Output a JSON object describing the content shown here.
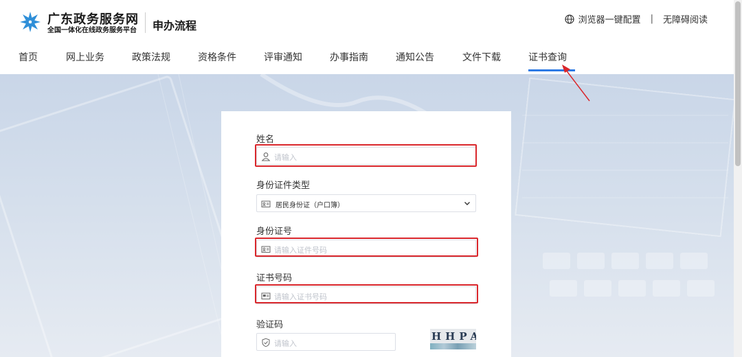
{
  "header": {
    "brand_title": "广东政务服务网",
    "brand_subtitle": "全国一体化在线政务服务平台",
    "section_title": "申办流程",
    "tools": {
      "browser_config": "浏览器一键配置",
      "separator": "|",
      "accessibility": "无障碍阅读"
    }
  },
  "nav": {
    "items": [
      {
        "label": "首页"
      },
      {
        "label": "网上业务"
      },
      {
        "label": "政策法规"
      },
      {
        "label": "资格条件"
      },
      {
        "label": "评审通知"
      },
      {
        "label": "办事指南"
      },
      {
        "label": "通知公告"
      },
      {
        "label": "文件下载"
      },
      {
        "label": "证书查询",
        "active": true
      }
    ]
  },
  "form": {
    "name": {
      "label": "姓名",
      "placeholder": "请输入"
    },
    "id_type": {
      "label": "身份证件类型",
      "value": "居民身份证（户口簿）"
    },
    "id_number": {
      "label": "身份证号",
      "placeholder": "请输入证件号码"
    },
    "cert_number": {
      "label": "证书号码",
      "placeholder": "请输入证书号码"
    },
    "captcha": {
      "label": "验证码",
      "placeholder": "请输入",
      "image_text": "HHPA"
    }
  },
  "colors": {
    "highlight": "#d9262b",
    "nav_active_underline": "#2d7be5",
    "logo": "#2f8fd8"
  },
  "icons": {
    "logo": "snowflake-logo-icon",
    "browser_config": "globe-icon",
    "name_field": "user-icon",
    "id_type_field": "id-card-icon",
    "id_number_field": "id-card-icon",
    "cert_number_field": "certificate-icon",
    "captcha_field": "shield-icon",
    "select": "chevron-down-icon"
  }
}
